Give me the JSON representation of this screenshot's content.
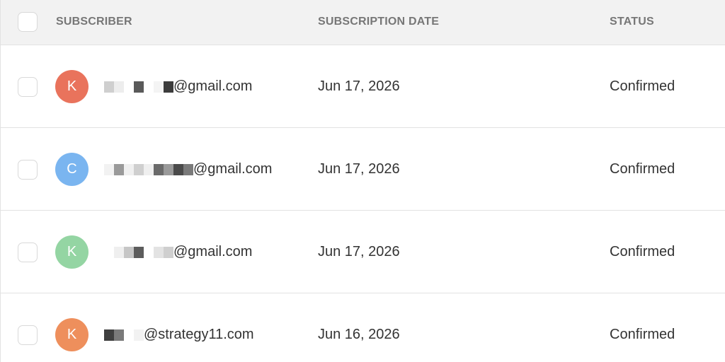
{
  "header": {
    "subscriber": "SUBSCRIBER",
    "subscription_date": "SUBSCRIPTION DATE",
    "status": "STATUS"
  },
  "rows": [
    {
      "initial": "K",
      "avatar_color": "#e9735c",
      "email_domain": "@gmail.com",
      "date": "Jun 17, 2026",
      "status": "Confirmed",
      "pixels": [
        "#cfcfcf",
        "#ededed",
        "#ffffff",
        "#5a5a5a",
        "#ffffff",
        "#f4f4f4",
        "#3c3c3c"
      ]
    },
    {
      "initial": "C",
      "avatar_color": "#7ab5f0",
      "email_domain": "@gmail.com",
      "date": "Jun 17, 2026",
      "status": "Confirmed",
      "pixels": [
        "#f2f2f2",
        "#9a9a9a",
        "#f0f0f0",
        "#cfcfcf",
        "#efefef",
        "#6a6a6a",
        "#9a9a9a",
        "#4a4a4a",
        "#7a7a7a"
      ]
    },
    {
      "initial": "K",
      "avatar_color": "#94d5a3",
      "email_domain": "@gmail.com",
      "date": "Jun 17, 2026",
      "status": "Confirmed",
      "pixels": [
        "#ffffff",
        "#efefef",
        "#c6c6c6",
        "#5c5c5c",
        "#ffffff",
        "#e3e3e3",
        "#cfcfcf"
      ]
    },
    {
      "initial": "K",
      "avatar_color": "#ee8f5c",
      "email_domain": "@strategy11.com",
      "date": "Jun 16, 2026",
      "status": "Confirmed",
      "pixels": [
        "#3f3f3f",
        "#7a7a7a",
        "#ffffff",
        "#f2f2f2"
      ]
    }
  ]
}
